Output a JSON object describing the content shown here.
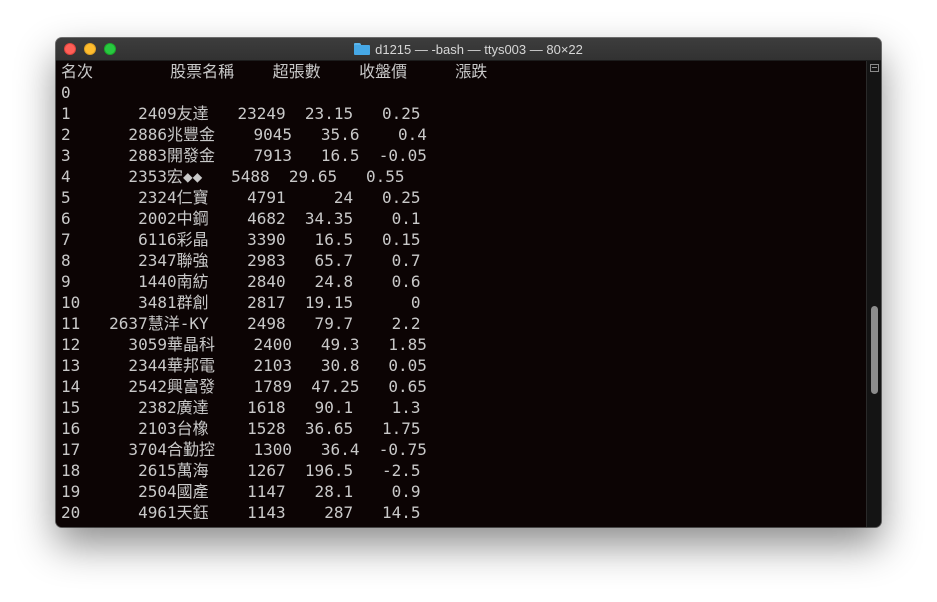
{
  "window": {
    "title": "d1215 — -bash — ttys003 — 80×22",
    "folder_icon": "folder-icon"
  },
  "terminal": {
    "lines": [
      "名次        股票名稱    超張數    收盤價     漲跌",
      "0",
      "1       2409友達   23249  23.15   0.25",
      "2      2886兆豐金    9045   35.6    0.4",
      "3      2883開發金    7913   16.5  -0.05",
      "4      2353宏◆◆   5488  29.65   0.55",
      "5       2324仁寶    4791     24   0.25",
      "6       2002中鋼    4682  34.35    0.1",
      "7       6116彩晶    3390   16.5   0.15",
      "8       2347聯強    2983   65.7    0.7",
      "9       1440南紡    2840   24.8    0.6",
      "10      3481群創    2817  19.15      0",
      "11   2637慧洋-KY    2498   79.7    2.2",
      "12     3059華晶科    2400   49.3   1.85",
      "13     2344華邦電    2103   30.8   0.05",
      "14     2542興富發    1789  47.25   0.65",
      "15      2382廣達    1618   90.1    1.3",
      "16      2103台橡    1528  36.65   1.75",
      "17     3704合勤控    1300   36.4  -0.75",
      "18      2615萬海    1267  196.5   -2.5",
      "19      2504國產    1147   28.1    0.9",
      "20      4961天鈺    1143    287   14.5"
    ]
  },
  "scrollbar": {
    "split_icon": "split-pane-icon"
  }
}
